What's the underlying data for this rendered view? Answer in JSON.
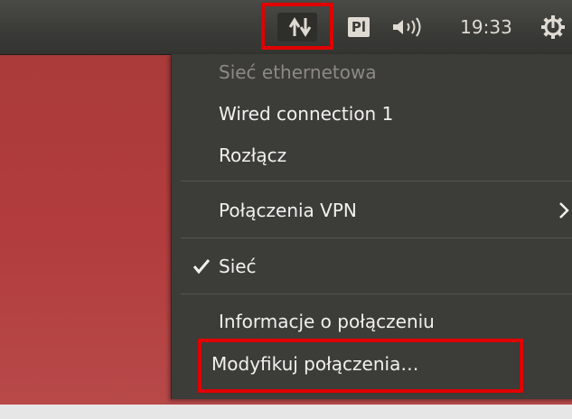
{
  "top_panel": {
    "network_icon": "network-up-down-arrows-icon",
    "keyboard_layout": "Pl",
    "sound_icon": "speaker-volume-icon",
    "clock": "19:33",
    "session_icon": "power-gear-icon"
  },
  "network_menu": {
    "section_header": "Sieć ethernetowa",
    "connection_name": "Wired connection 1",
    "disconnect": "Rozłącz",
    "vpn": "Połączenia VPN",
    "network_toggle": "Sieć",
    "network_toggle_checked": true,
    "connection_info": "Informacje o połączeniu",
    "edit_connections": "Modyfikuj połączenia…"
  },
  "colors": {
    "highlight": "#e00000",
    "panel": "#3c3c39",
    "desktop": "#b03c3e"
  }
}
